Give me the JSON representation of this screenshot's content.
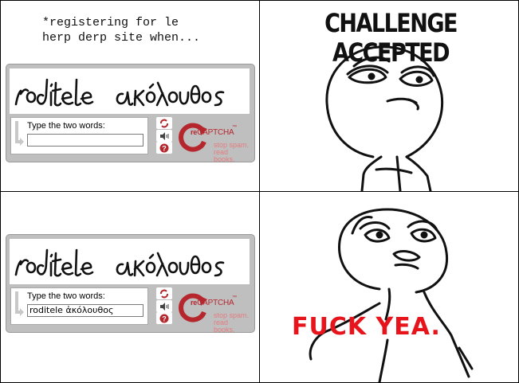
{
  "panel1": {
    "caption_line1": "*registering for le",
    "caption_line2": "herp derp site when...",
    "captcha": {
      "words_image": [
        "roditele",
        "ακόλουθος"
      ],
      "prompt_label": "Type the two words:",
      "input_value": "",
      "logo_prefix": "re",
      "logo_text": "CAPTCHA",
      "logo_tm": "™",
      "tagline_line1": "stop spam.",
      "tagline_line2": "read books."
    }
  },
  "panel2": {
    "title": "CHALLENGE ACCEPTED",
    "face": "challenge-accepted-face"
  },
  "panel3": {
    "captcha": {
      "words_image": [
        "roditele",
        "ακόλουθος"
      ],
      "prompt_label": "Type the two words:",
      "input_value": "roditele ἀκόλουθος",
      "logo_prefix": "re",
      "logo_text": "CAPTCHA",
      "logo_tm": "™",
      "tagline_line1": "stop spam.",
      "tagline_line2": "read books."
    }
  },
  "panel4": {
    "caption": "FUCK YEA.",
    "face": "fuck-yea-face"
  },
  "colors": {
    "captcha_red": "#b5272d",
    "captcha_bg": "#bfbfbf",
    "yea_red": "#e8141c"
  }
}
